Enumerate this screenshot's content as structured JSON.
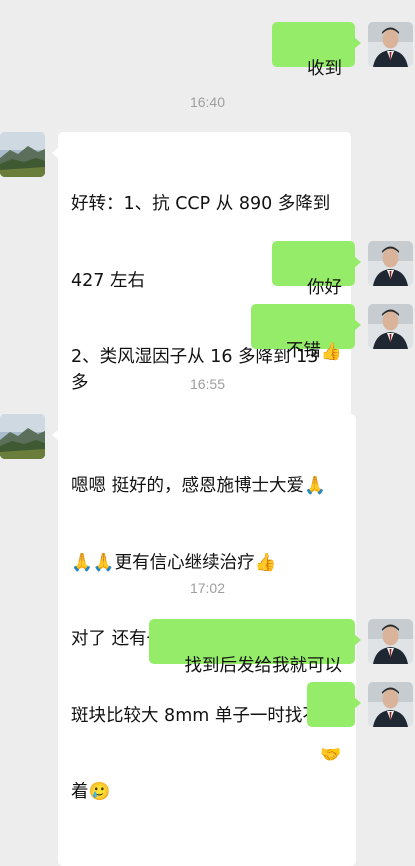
{
  "messages": [
    {
      "type": "out",
      "text": "收到"
    },
    {
      "type": "time",
      "text": "16:40"
    },
    {
      "type": "in",
      "lines": [
        "好转：1、抗 CCP 从 890 多降到",
        "427 左右",
        "2、类风湿因子从 16 多降到 13 多"
      ]
    },
    {
      "type": "out",
      "text": "你好"
    },
    {
      "type": "out",
      "text": "不错",
      "emoji": "👍"
    },
    {
      "type": "time",
      "text": "16:55"
    },
    {
      "type": "in",
      "lines": [
        "嗯嗯 挺好的，感恩施博士大爱🙏",
        "🙏🙏更有信心继续治疗👍",
        "对了 还有一个超声波颈动脉左侧",
        "斑块比较大 8mm 单子一时找不",
        "着🥲"
      ]
    },
    {
      "type": "time",
      "text": "17:02"
    },
    {
      "type": "out",
      "text": "找到后发给我就可以"
    },
    {
      "type": "out",
      "emoji": "🤝"
    }
  ],
  "colors": {
    "outgoing": "#95ec69",
    "incoming": "#ffffff",
    "background": "#ededed"
  },
  "avatars": {
    "self": "man-in-suit-avatar",
    "other": "mountain-landscape-avatar"
  }
}
